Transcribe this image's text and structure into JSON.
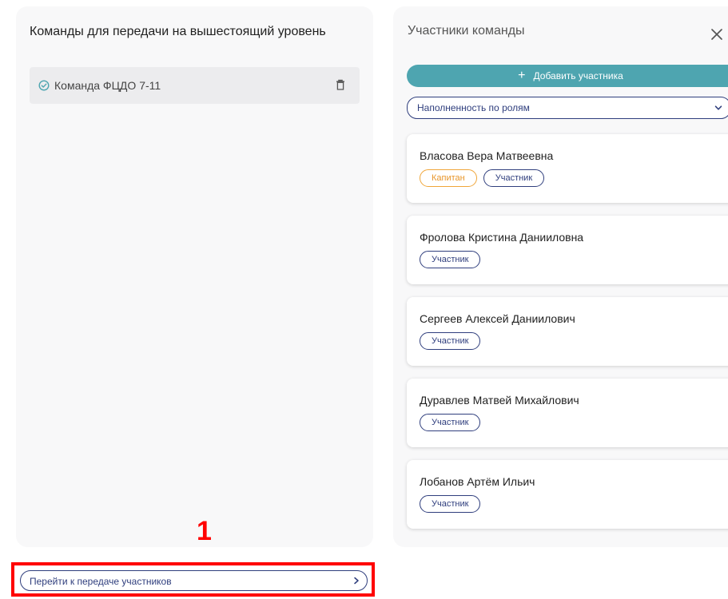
{
  "left": {
    "title": "Команды для передачи на вышестоящий уровень",
    "teams": [
      {
        "name": "Команда ФЦДО 7-11"
      }
    ]
  },
  "right": {
    "title": "Участники команды",
    "add_button_label": "Добавить участника",
    "roles_select_label": "Наполненность по ролям",
    "members": [
      {
        "name": "Власова Вера Матвеевна",
        "roles": [
          "Капитан",
          "Участник"
        ]
      },
      {
        "name": "Фролова Кристина Данииловна",
        "roles": [
          "Участник"
        ]
      },
      {
        "name": "Сергеев Алексей Даниилович",
        "roles": [
          "Участник"
        ]
      },
      {
        "name": "Дуравлев Матвей Михайлович",
        "roles": [
          "Участник"
        ]
      },
      {
        "name": "Лобанов Артём Ильич",
        "roles": [
          "Участник"
        ]
      }
    ]
  },
  "footer": {
    "transfer_button_label": "Перейти к передаче участников"
  },
  "annotation": {
    "number": "1",
    "color": "#ff0000"
  },
  "colors": {
    "accent": "#4ea5b0",
    "navy": "#2f3e7d",
    "captain": "#f0a63a"
  },
  "icons": [
    "check-circle-icon",
    "trash-icon",
    "close-icon",
    "plus-icon",
    "chevron-down-icon",
    "chevron-right-icon"
  ]
}
